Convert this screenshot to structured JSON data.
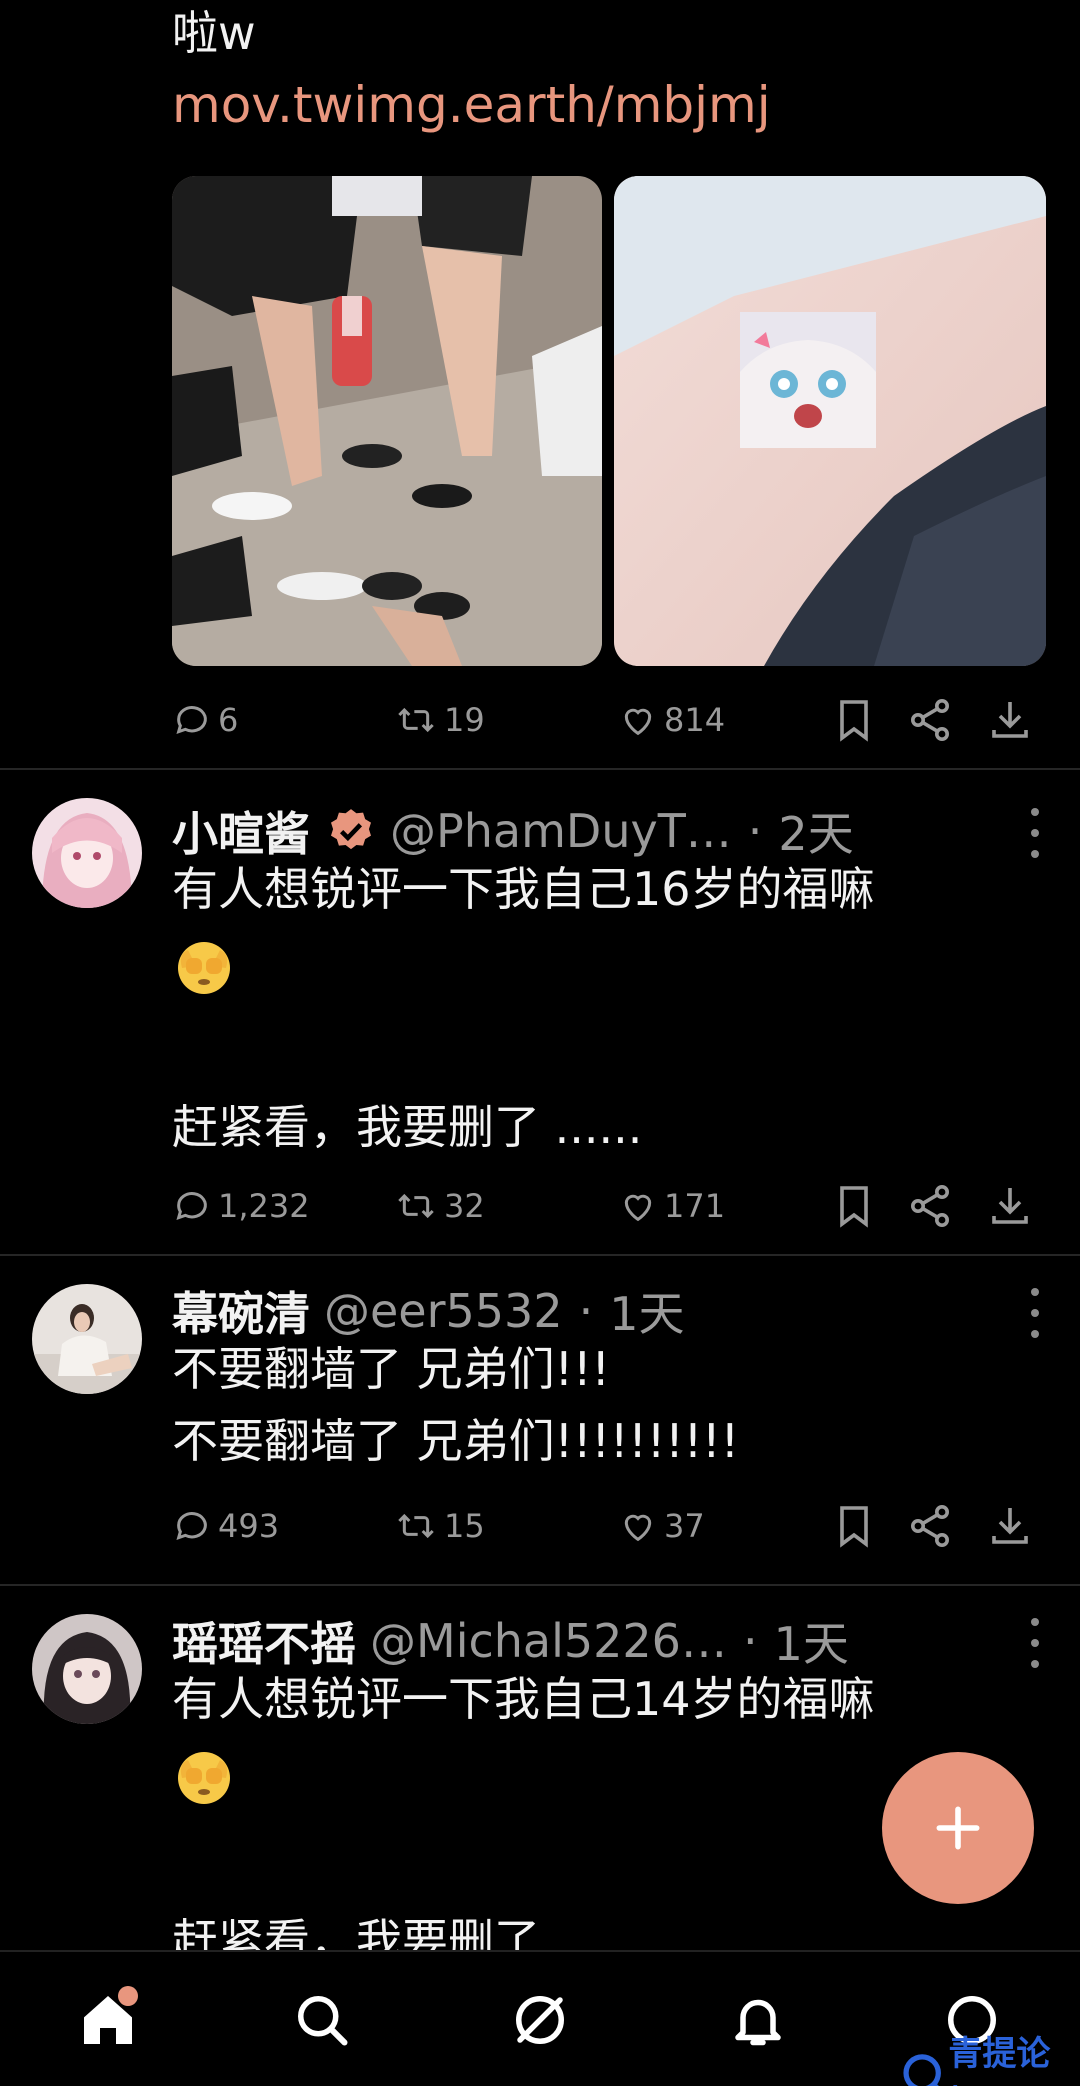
{
  "post0": {
    "text_tail": "啦w",
    "link": "mov.twimg.earth/mbjmj",
    "stats": {
      "replies": "6",
      "reposts": "19",
      "likes": "814"
    }
  },
  "post1": {
    "name": "小暄酱",
    "handle": "@PhamDuyT…",
    "time": "2天",
    "line1": "有人想锐评一下我自己16岁的福嘛",
    "line2": "赶紧看，我要删了 ......",
    "stats": {
      "replies": "1,232",
      "reposts": "32",
      "likes": "171"
    }
  },
  "post2": {
    "name": "幕碗清",
    "handle": "@eer5532",
    "time": "1天",
    "line1": "不要翻墙了 兄弟们!!!",
    "line2": "不要翻墙了 兄弟们!!!!!!!!!!",
    "stats": {
      "replies": "493",
      "reposts": "15",
      "likes": "37"
    }
  },
  "post3": {
    "name": "瑶瑶不摇",
    "handle": "@Michal5226…",
    "time": "1天",
    "line1": "有人想锐评一下我自己14岁的福嘛",
    "line2": "赶紧看，我要删了"
  },
  "nav": {
    "items": [
      "home-icon",
      "search-icon",
      "explore-icon",
      "bell-icon",
      "chat-icon"
    ]
  },
  "watermark": "青提论坛",
  "colors": {
    "accent": "#e8967e",
    "background": "#000000",
    "muted": "#9a9a9a"
  }
}
